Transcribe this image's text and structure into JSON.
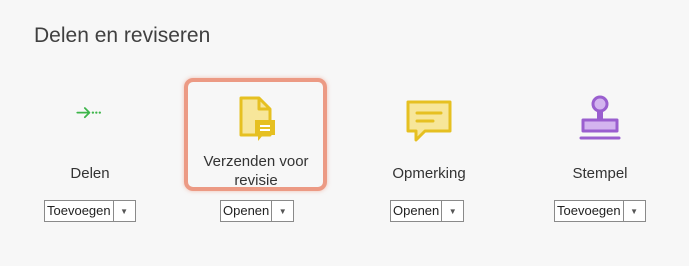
{
  "section": {
    "title": "Delen en reviseren"
  },
  "tools": [
    {
      "name": "Delen",
      "button": "Toevoegen",
      "icon": "share-arrow-icon",
      "color": "#3db54a"
    },
    {
      "name": "Verzenden voor revisie",
      "button": "Openen",
      "icon": "send-for-review-icon",
      "color": "#e6c021",
      "highlighted": true
    },
    {
      "name": "Opmerking",
      "button": "Openen",
      "icon": "comment-icon",
      "color": "#e6c021"
    },
    {
      "name": "Stempel",
      "button": "Toevoegen",
      "icon": "stamp-icon",
      "color": "#9a5fcf"
    }
  ],
  "highlight_color": "#ec9a84"
}
